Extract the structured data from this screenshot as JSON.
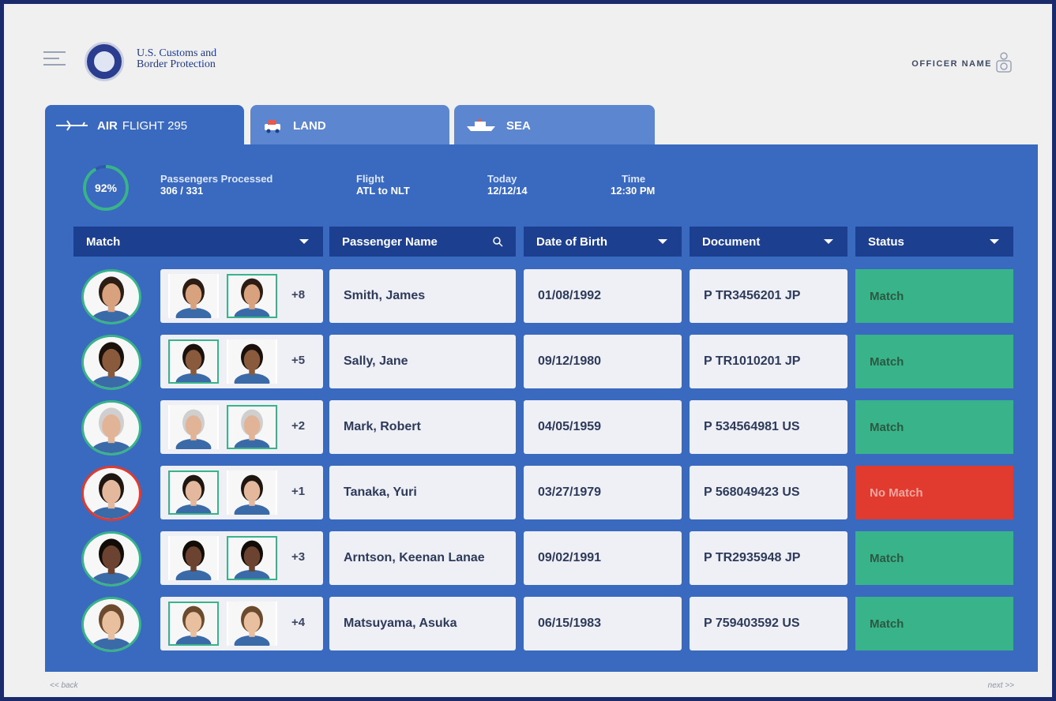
{
  "header": {
    "agency_line1": "U.S. Customs and",
    "agency_line2": "Border Protection",
    "officer_name": "OFFICER NAME"
  },
  "tabs": [
    {
      "label_bold": "AIR",
      "label_light": "FLIGHT 295",
      "icon": "airplane-icon",
      "active": true
    },
    {
      "label_bold": "LAND",
      "label_light": "",
      "icon": "car-icon",
      "active": false
    },
    {
      "label_bold": "SEA",
      "label_light": "",
      "icon": "ship-icon",
      "active": false
    }
  ],
  "summary": {
    "progress_percent": 92,
    "progress_label": "92%",
    "processed_label": "Passengers Processed",
    "processed_value": "306 / 331",
    "flight_label": "Flight",
    "flight_value": "ATL to NLT",
    "today_label": "Today",
    "today_value": "12/12/14",
    "time_label": "Time",
    "time_value": "12:30 PM"
  },
  "columns": {
    "match": "Match",
    "passenger_name": "Passenger Name",
    "dob": "Date of Birth",
    "document": "Document",
    "status": "Status"
  },
  "passengers": [
    {
      "name": "Smith, James",
      "dob": "01/08/1992",
      "document": "P TR3456201 JP",
      "status": "Match",
      "more": "+8",
      "matched": true,
      "skin": "#d9a27e",
      "hair": "#2b1d14"
    },
    {
      "name": "Sally, Jane",
      "dob": "09/12/1980",
      "document": "P TR1010201 JP",
      "status": "Match",
      "more": "+5",
      "matched": true,
      "skin": "#8a5a3c",
      "hair": "#1a110c"
    },
    {
      "name": "Mark, Robert",
      "dob": "04/05/1959",
      "document": "P 534564981 US",
      "status": "Match",
      "more": "+2",
      "matched": true,
      "skin": "#e2b497",
      "hair": "#cfcfcf"
    },
    {
      "name": "Tanaka, Yuri",
      "dob": "03/27/1979",
      "document": "P 568049423 US",
      "status": "No Match",
      "more": "+1",
      "matched": false,
      "skin": "#e3b89c",
      "hair": "#1f1611"
    },
    {
      "name": "Arntson, Keenan Lanae",
      "dob": "09/02/1991",
      "document": "P TR2935948 JP",
      "status": "Match",
      "more": "+3",
      "matched": true,
      "skin": "#6b4330",
      "hair": "#120c08"
    },
    {
      "name": "Matsuyama, Asuka",
      "dob": "06/15/1983",
      "document": "P 759403592 US",
      "status": "Match",
      "more": "+4",
      "matched": true,
      "skin": "#e8bf9f",
      "hair": "#6b4a2e"
    }
  ],
  "footer": {
    "back": "<< back",
    "next": "next >>"
  },
  "colors": {
    "panel": "#3a69c0",
    "header_cell": "#1d3f8f",
    "match_green": "#39b38a",
    "no_match_red": "#e03b2e"
  }
}
